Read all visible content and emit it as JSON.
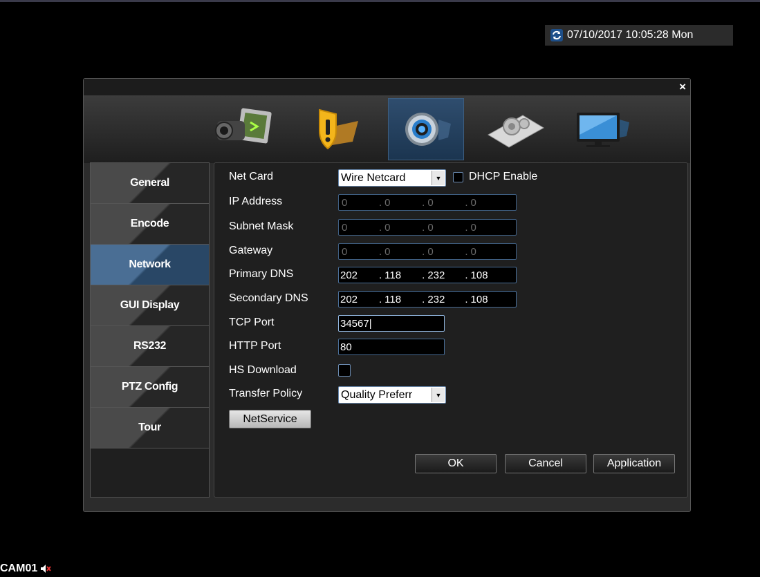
{
  "clock": {
    "datetime": "07/10/2017 10:05:28 Mon",
    "icon": "sync-icon"
  },
  "window": {
    "close_label": "×"
  },
  "top_icons": [
    {
      "name": "record-camera-icon"
    },
    {
      "name": "alarm-shield-icon"
    },
    {
      "name": "system-gear-icon",
      "active": true
    },
    {
      "name": "advanced-settings-icon"
    },
    {
      "name": "monitor-info-icon"
    }
  ],
  "sidebar": {
    "items": [
      {
        "label": "General"
      },
      {
        "label": "Encode"
      },
      {
        "label": "Network",
        "active": true
      },
      {
        "label": "GUI Display"
      },
      {
        "label": "RS232"
      },
      {
        "label": "PTZ Config"
      },
      {
        "label": "Tour"
      }
    ]
  },
  "network": {
    "net_card": {
      "label": "Net Card",
      "value": "Wire Netcard"
    },
    "dhcp": {
      "label": "DHCP Enable",
      "checked": false
    },
    "ip_address": {
      "label": "IP Address",
      "segments": [
        "0",
        "0",
        "0",
        "0"
      ]
    },
    "subnet_mask": {
      "label": "Subnet Mask",
      "segments": [
        "0",
        "0",
        "0",
        "0"
      ]
    },
    "gateway": {
      "label": "Gateway",
      "segments": [
        "0",
        "0",
        "0",
        "0"
      ]
    },
    "primary_dns": {
      "label": "Primary DNS",
      "segments": [
        "202",
        "118",
        "232",
        "108"
      ]
    },
    "secondary_dns": {
      "label": "Secondary DNS",
      "segments": [
        "202",
        "118",
        "232",
        "108"
      ]
    },
    "tcp_port": {
      "label": "TCP Port",
      "value": "34567|"
    },
    "http_port": {
      "label": "HTTP Port",
      "value": "80"
    },
    "hs_download": {
      "label": "HS Download",
      "checked": false
    },
    "transfer_policy": {
      "label": "Transfer Policy",
      "value": "Quality Preferr"
    },
    "netservice_label": "NetService"
  },
  "buttons": {
    "ok": "OK",
    "cancel": "Cancel",
    "application": "Application"
  },
  "camera": {
    "label": "CAM01",
    "icon": "speaker-muted-icon"
  }
}
